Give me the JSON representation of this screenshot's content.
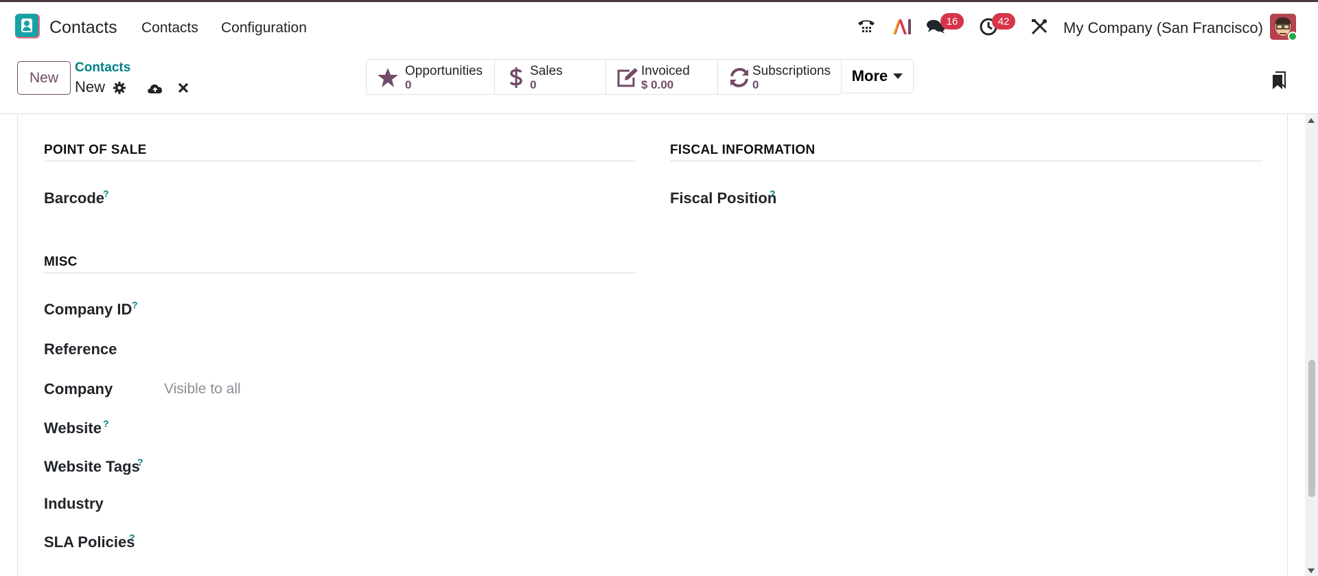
{
  "navbar": {
    "app_name": "Contacts",
    "menus": [
      "Contacts",
      "Configuration"
    ],
    "chat_badge": "16",
    "activity_badge": "42",
    "company": "My Company (San Francisco)",
    "ai_label": "AI"
  },
  "control": {
    "new_button": "New",
    "breadcrumb_parent": "Contacts",
    "breadcrumb_current": "New",
    "stats": [
      {
        "label": "Opportunities",
        "value": "0",
        "icon": "star-icon"
      },
      {
        "label": "Sales",
        "value": "0",
        "icon": "dollar-icon"
      },
      {
        "label": "Invoiced",
        "value": "$ 0.00",
        "icon": "pencil-square-icon"
      },
      {
        "label": "Subscriptions",
        "value": "0",
        "icon": "refresh-icon"
      }
    ],
    "more_button": "More"
  },
  "sections": {
    "pos_title": "POINT OF SALE",
    "fiscal_title": "FISCAL INFORMATION",
    "misc_title": "MISC"
  },
  "fields": {
    "barcode": "Barcode",
    "fiscal_position": "Fiscal Position",
    "company_id": "Company ID",
    "reference": "Reference",
    "company": "Company",
    "company_placeholder": "Visible to all",
    "website": "Website",
    "website_tags": "Website Tags",
    "industry": "Industry",
    "sla_policies": "SLA Policies",
    "help_mark": "?"
  },
  "colors": {
    "brand": "#714b67",
    "link": "#017e84",
    "badge": "#d6354a"
  }
}
